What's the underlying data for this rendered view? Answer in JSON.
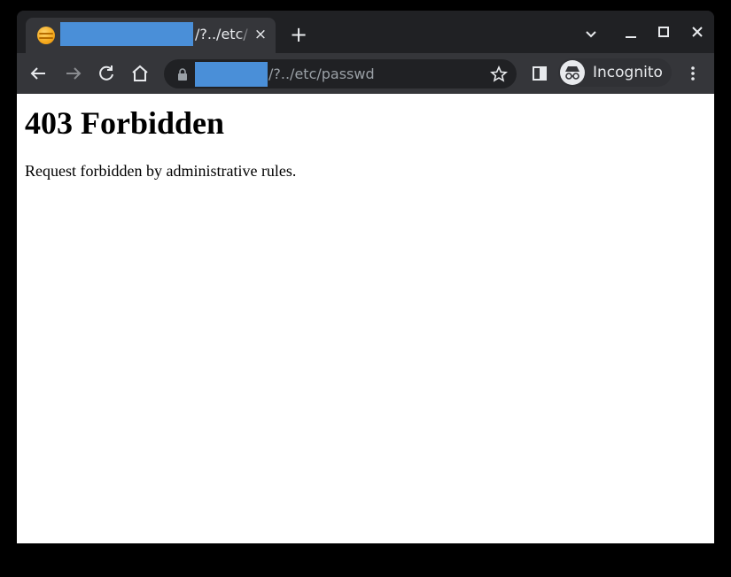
{
  "browser": {
    "tab": {
      "title": "/?../etc/",
      "close_symbol": "×",
      "favicon_icon": "site-favicon-icon"
    },
    "new_tab_symbol": "+",
    "address_bar": {
      "url_visible": "/?../etc/passwd"
    },
    "profile": {
      "label": "Incognito"
    },
    "colors": {
      "frame": "#202124",
      "toolbar": "#35363a",
      "redaction": "#4a8fd8"
    }
  },
  "page": {
    "heading": "403 Forbidden",
    "message": "Request forbidden by administrative rules."
  }
}
